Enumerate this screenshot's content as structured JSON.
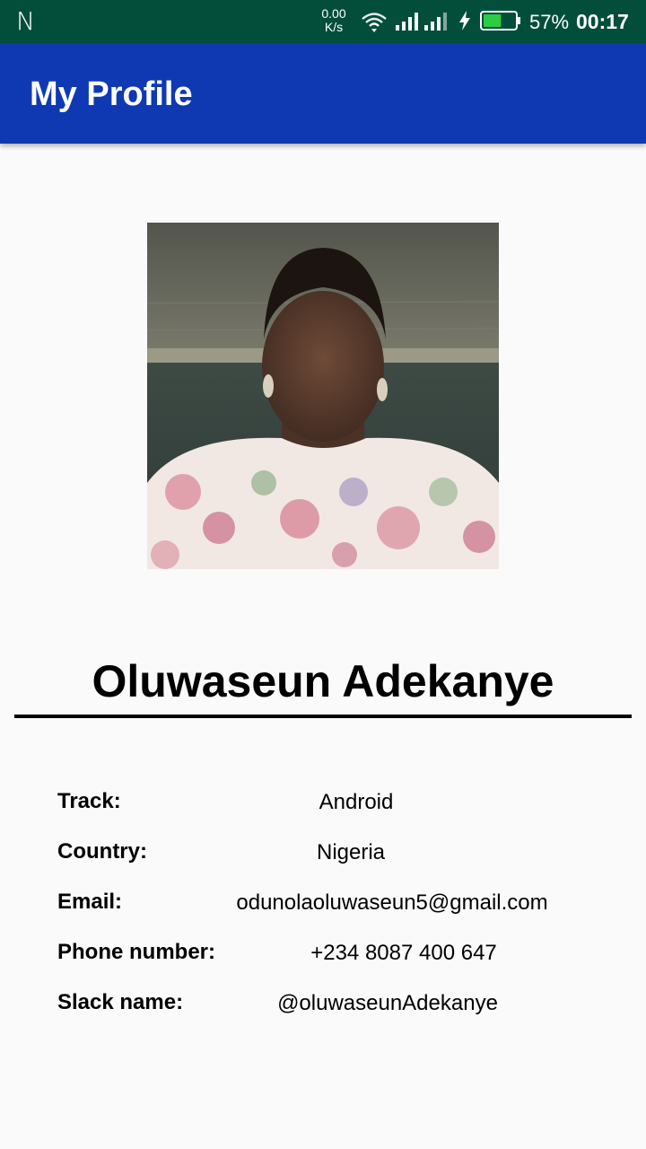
{
  "status_bar": {
    "carrier_glyph": "N",
    "net_speed_value": "0.00",
    "net_speed_unit": "K/s",
    "battery_percent": "57%",
    "time": "00:17",
    "icons": [
      "wifi-icon",
      "signal-icon",
      "signal-icon",
      "charging-icon",
      "battery-icon"
    ],
    "battery_level": 0.57
  },
  "app_bar": {
    "title": "My Profile"
  },
  "profile": {
    "photo_alt": "Profile photo",
    "name": "Oluwaseun Adekanye",
    "details": [
      {
        "label": "Track:",
        "value": "Android"
      },
      {
        "label": "Country:",
        "value": "Nigeria"
      },
      {
        "label": "Email:",
        "value": "odunolaoluwaseun5@gmail.com"
      },
      {
        "label": "Phone number:",
        "value": "+234 8087 400 647"
      },
      {
        "label": "Slack name:",
        "value": "@oluwaseunAdekanye"
      }
    ]
  },
  "colors": {
    "status_bar": "#034e3b",
    "app_bar": "#0f39b2",
    "background": "#fafafa",
    "battery_fill": "#2ecc40"
  }
}
